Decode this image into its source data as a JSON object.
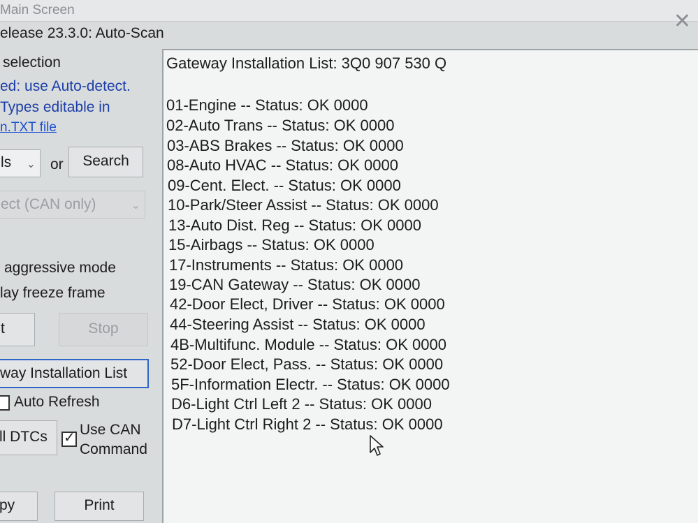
{
  "window": {
    "title": "Main Screen",
    "subtitle": "elease 23.3.0:  Auto-Scan"
  },
  "left_panel": {
    "selection_heading": "selection",
    "info_line1": "ed: use Auto-detect.",
    "info_line2": "Types editable in",
    "txt_file_link": "n.TXT file",
    "type_select_value": "ls",
    "or_label": "or",
    "search_button": "Search",
    "protocol_select_value": "ect (CAN only)",
    "aggressive_mode_label": "aggressive mode",
    "freeze_frame_label": "lay freeze frame",
    "start_button": "t",
    "stop_button": "Stop",
    "gateway_button": "way Installation List",
    "auto_refresh_label": "Auto Refresh",
    "all_dtcs_button": "ll DTCs",
    "use_can_line1": "Use CAN",
    "use_can_line2": "Command",
    "copy_button": "py",
    "print_button": "Print"
  },
  "results": {
    "header": "Gateway Installation List:  3Q0 907 530 Q",
    "modules": [
      "01-Engine -- Status: OK 0000",
      "02-Auto Trans -- Status: OK 0000",
      "03-ABS Brakes -- Status: OK 0000",
      "08-Auto HVAC -- Status: OK 0000",
      "09-Cent. Elect. -- Status: OK 0000",
      "10-Park/Steer Assist -- Status: OK 0000",
      "13-Auto Dist. Reg -- Status: OK 0000",
      "15-Airbags -- Status: OK 0000",
      "17-Instruments -- Status: OK 0000",
      "19-CAN Gateway -- Status: OK 0000",
      "42-Door Elect, Driver -- Status: OK 0000",
      "44-Steering Assist -- Status: OK 0000",
      "4B-Multifunc. Module -- Status: OK 0000",
      "52-Door Elect, Pass. -- Status: OK 0000",
      "5F-Information Electr. -- Status: OK 0000",
      "D6-Light Ctrl Left 2 -- Status: OK 0000",
      "D7-Light Ctrl Right 2 -- Status: OK 0000"
    ]
  }
}
